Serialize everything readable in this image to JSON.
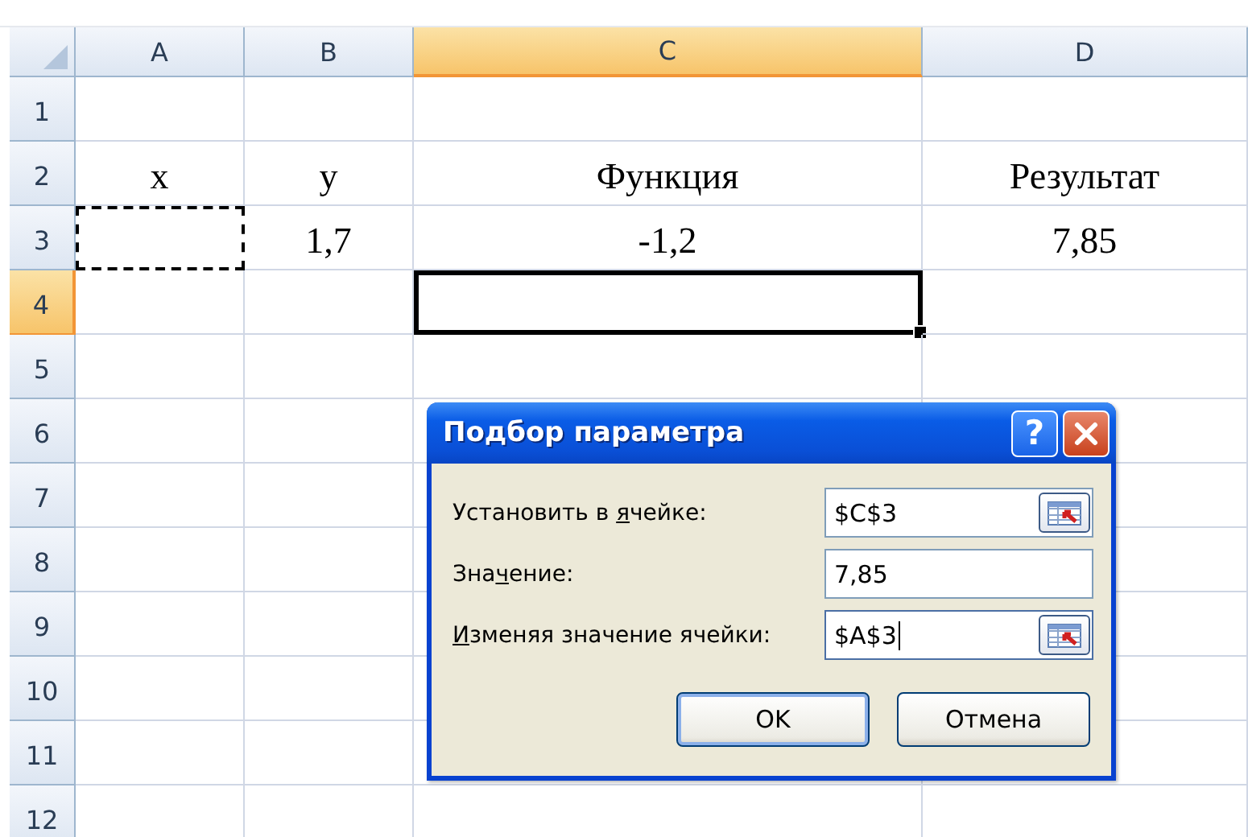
{
  "sheet": {
    "columns": [
      {
        "label": "A",
        "selected": false
      },
      {
        "label": "B",
        "selected": false
      },
      {
        "label": "C",
        "selected": true
      },
      {
        "label": "D",
        "selected": false
      }
    ],
    "rows": [
      {
        "label": "1",
        "selected": false,
        "cells": [
          {
            "selected": false,
            "copied": false
          },
          {
            "selected": false,
            "copied": false
          },
          {
            "selected": false,
            "copied": false
          },
          {
            "selected": false,
            "copied": false
          }
        ]
      },
      {
        "label": "2",
        "selected": false,
        "cells": [
          {
            "text": "x",
            "selected": false,
            "copied": false
          },
          {
            "text": "y",
            "selected": false,
            "copied": false
          },
          {
            "text": "Функция",
            "selected": false,
            "copied": false
          },
          {
            "text": "Результат",
            "selected": false,
            "copied": false
          }
        ]
      },
      {
        "label": "3",
        "selected": false,
        "cells": [
          {
            "selected": false,
            "copied": true
          },
          {
            "text": "1,7",
            "selected": false,
            "copied": false
          },
          {
            "text": "-1,2",
            "selected": false,
            "copied": false
          },
          {
            "text": "7,85",
            "selected": false,
            "copied": false
          }
        ]
      },
      {
        "label": "4",
        "selected": true,
        "cells": [
          {
            "selected": false,
            "copied": false
          },
          {
            "selected": false,
            "copied": false
          },
          {
            "selected": true,
            "copied": false
          },
          {
            "selected": false,
            "copied": false
          }
        ]
      },
      {
        "label": "5",
        "selected": false,
        "cells": [
          {
            "selected": false,
            "copied": false
          },
          {
            "selected": false,
            "copied": false
          },
          {
            "selected": false,
            "copied": false
          },
          {
            "selected": false,
            "copied": false
          }
        ]
      },
      {
        "label": "6",
        "selected": false,
        "cells": [
          {
            "selected": false,
            "copied": false
          },
          {
            "selected": false,
            "copied": false
          },
          {
            "selected": false,
            "copied": false
          },
          {
            "selected": false,
            "copied": false
          }
        ]
      },
      {
        "label": "7",
        "selected": false,
        "cells": [
          {
            "selected": false,
            "copied": false
          },
          {
            "selected": false,
            "copied": false
          },
          {
            "selected": false,
            "copied": false
          },
          {
            "selected": false,
            "copied": false
          }
        ]
      },
      {
        "label": "8",
        "selected": false,
        "cells": [
          {
            "selected": false,
            "copied": false
          },
          {
            "selected": false,
            "copied": false
          },
          {
            "selected": false,
            "copied": false
          },
          {
            "selected": false,
            "copied": false
          }
        ]
      },
      {
        "label": "9",
        "selected": false,
        "cells": [
          {
            "selected": false,
            "copied": false
          },
          {
            "selected": false,
            "copied": false
          },
          {
            "selected": false,
            "copied": false
          },
          {
            "selected": false,
            "copied": false
          }
        ]
      },
      {
        "label": "10",
        "selected": false,
        "cells": [
          {
            "selected": false,
            "copied": false
          },
          {
            "selected": false,
            "copied": false
          },
          {
            "selected": false,
            "copied": false
          },
          {
            "selected": false,
            "copied": false
          }
        ]
      },
      {
        "label": "11",
        "selected": false,
        "cells": [
          {
            "selected": false,
            "copied": false
          },
          {
            "selected": false,
            "copied": false
          },
          {
            "selected": false,
            "copied": false
          },
          {
            "selected": false,
            "copied": false
          }
        ]
      },
      {
        "label": "12",
        "selected": false,
        "cells": [
          {
            "selected": false,
            "copied": false
          },
          {
            "selected": false,
            "copied": false
          },
          {
            "selected": false,
            "copied": false
          },
          {
            "selected": false,
            "copied": false
          }
        ]
      }
    ]
  },
  "dialog": {
    "title": "Подбор параметра",
    "help_button": "?",
    "close_button": true,
    "fields": [
      {
        "kind": "reference",
        "label": {
          "before": "Установить в ",
          "access_key": "я",
          "after": "чейке:"
        },
        "value": "$C$3",
        "focused": false
      },
      {
        "kind": "value",
        "label": {
          "before": "Зна",
          "access_key": "ч",
          "after": "ение:"
        },
        "value": "7,85",
        "focused": false
      },
      {
        "kind": "reference",
        "label": {
          "access_key": "И",
          "after": "зменяя значение ячейки:"
        },
        "value": "$A$3",
        "focused": true
      }
    ],
    "buttons": [
      {
        "label": "OK",
        "default": true
      },
      {
        "label": "Отмена",
        "default": false
      }
    ]
  }
}
